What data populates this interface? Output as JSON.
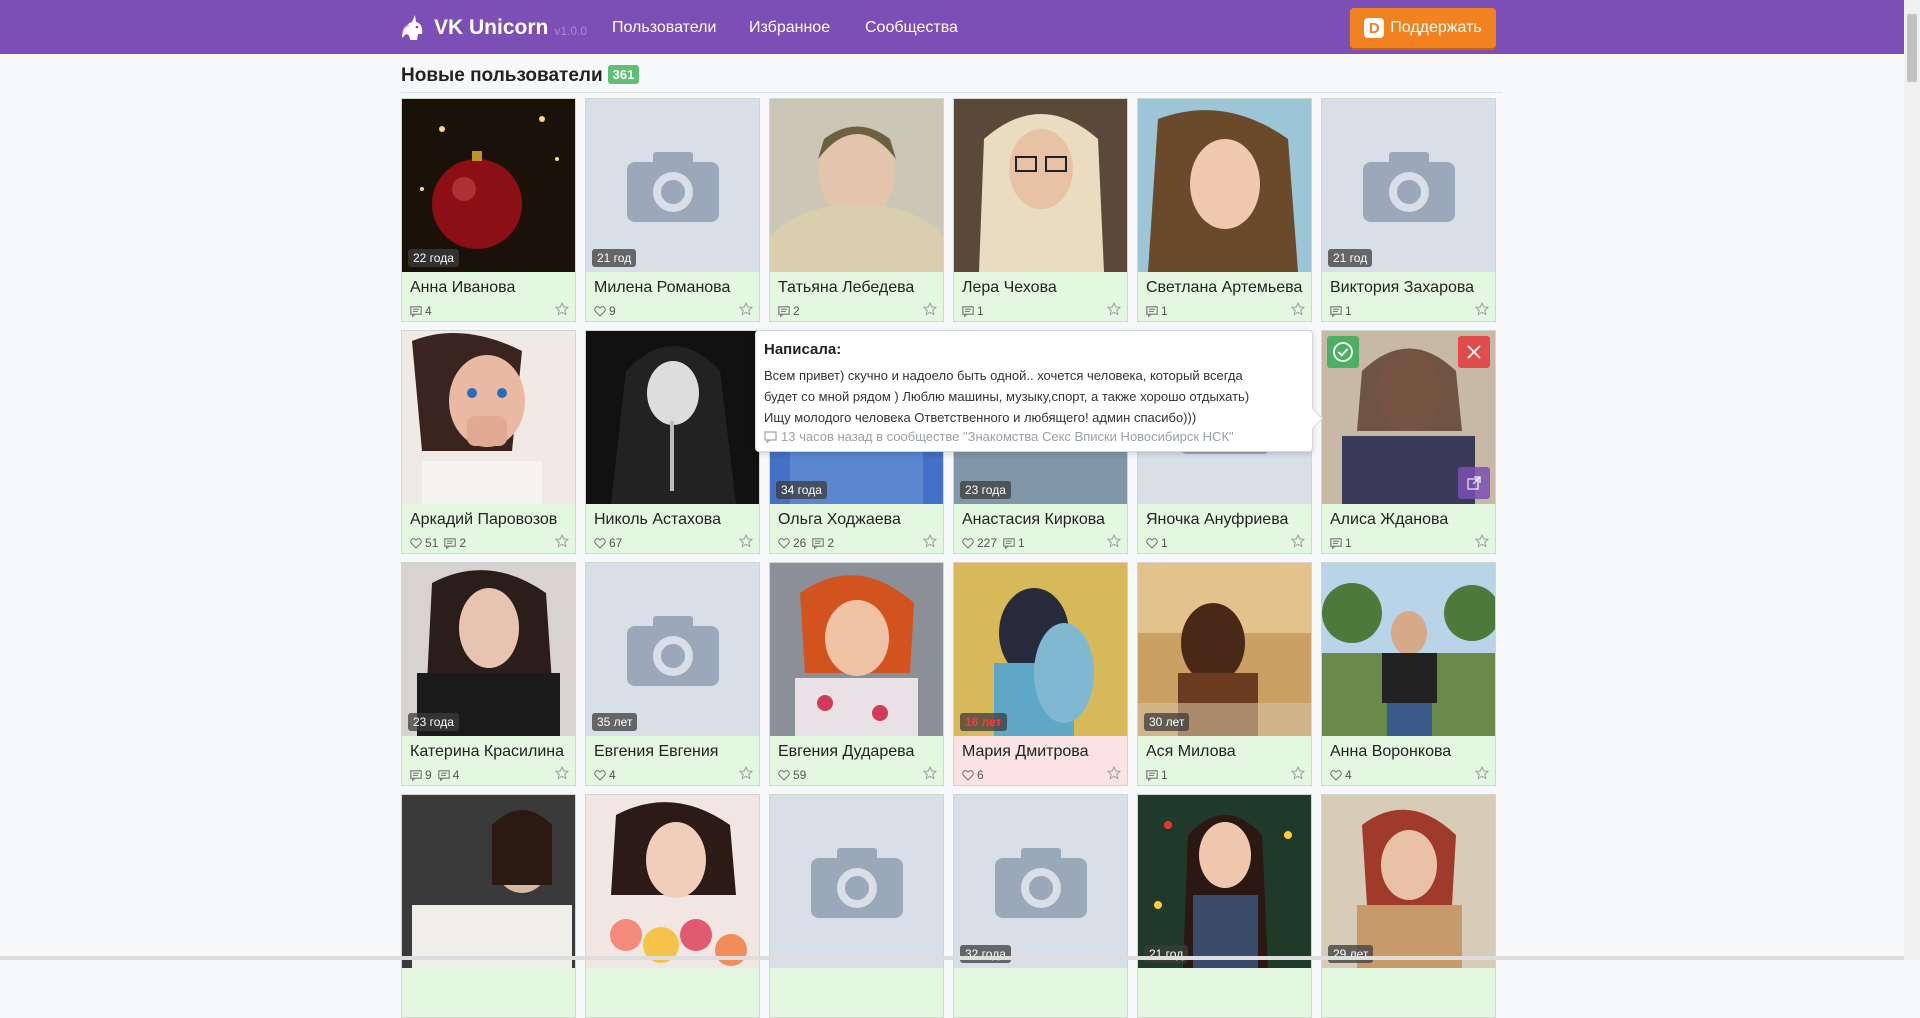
{
  "app": {
    "name": "VK Unicorn",
    "version": "v1.0.0",
    "nav": [
      "Пользователи",
      "Избранное",
      "Сообщества"
    ],
    "donate": "Поддержать",
    "donate_icon_letter": "D"
  },
  "section": {
    "title": "Новые пользователи",
    "count": "361"
  },
  "users": [
    {
      "name": "Анна Иванова",
      "age": "22 года",
      "likes": "",
      "comments": "4",
      "photo": "red-ornament",
      "highlight": false
    },
    {
      "name": "Милена Романова",
      "age": "21 год",
      "likes": "9",
      "comments": "",
      "photo": "placeholder",
      "highlight": false
    },
    {
      "name": "Татьяна Лебедева",
      "age": "",
      "likes": "",
      "comments": "2",
      "photo": "fur-coat",
      "highlight": false
    },
    {
      "name": "Лера Чехова",
      "age": "",
      "likes": "",
      "comments": "1",
      "photo": "glasses-blonde",
      "highlight": false
    },
    {
      "name": "Светлана Артемьева",
      "age": "",
      "likes": "",
      "comments": "1",
      "photo": "selfie",
      "highlight": false
    },
    {
      "name": "Виктория Захарова",
      "age": "21 год",
      "likes": "",
      "comments": "1",
      "photo": "placeholder",
      "highlight": false
    },
    {
      "name": "Аркадий Паровозов",
      "age": "",
      "likes": "51",
      "comments": "2",
      "photo": "blue-nails",
      "highlight": false
    },
    {
      "name": "Николь Астахова",
      "age": "",
      "likes": "67",
      "comments": "",
      "photo": "black-white",
      "highlight": false
    },
    {
      "name": "Ольга Ходжаева",
      "age": "34 года",
      "likes": "26",
      "comments": "2",
      "photo": "blue",
      "highlight": false
    },
    {
      "name": "Анастасия Киркова",
      "age": "23 года",
      "likes": "227",
      "comments": "1",
      "photo": "beach",
      "highlight": false
    },
    {
      "name": "Яночка Ануфриева",
      "age": "",
      "likes": "1",
      "comments": "",
      "photo": "placeholder",
      "highlight": false
    },
    {
      "name": "Алиса Жданова",
      "age": "",
      "likes": "",
      "comments": "1",
      "photo": "jacket",
      "highlight": false
    },
    {
      "name": "Катерина Красилина",
      "age": "23 года",
      "likes": "",
      "comments": "9",
      "extra": "4",
      "photo": "dark-jacket",
      "highlight": false
    },
    {
      "name": "Евгения Евгения",
      "age": "35 лет",
      "likes": "4",
      "comments": "",
      "photo": "placeholder",
      "highlight": false
    },
    {
      "name": "Евгения Дударева",
      "age": "",
      "likes": "59",
      "comments": "",
      "photo": "redhead",
      "highlight": false
    },
    {
      "name": "Мария Дмитрова",
      "age": "16 лет",
      "likes": "6",
      "comments": "",
      "photo": "couple",
      "highlight": true
    },
    {
      "name": "Ася Милова",
      "age": "30 лет",
      "likes": "",
      "comments": "1",
      "photo": "sepia",
      "highlight": false
    },
    {
      "name": "Анна Воронкова",
      "age": "",
      "likes": "4",
      "comments": "",
      "photo": "park",
      "highlight": false
    },
    {
      "name": "",
      "age": "",
      "likes": "",
      "comments": "",
      "photo": "car",
      "highlight": false
    },
    {
      "name": "",
      "age": "",
      "likes": "",
      "comments": "",
      "photo": "flowers",
      "highlight": false
    },
    {
      "name": "",
      "age": "",
      "likes": "",
      "comments": "",
      "photo": "placeholder",
      "highlight": false
    },
    {
      "name": "",
      "age": "32 года",
      "likes": "",
      "comments": "",
      "photo": "placeholder",
      "highlight": false
    },
    {
      "name": "",
      "age": "21 год",
      "likes": "",
      "comments": "",
      "photo": "xmas",
      "highlight": false
    },
    {
      "name": "",
      "age": "29 лет",
      "likes": "",
      "comments": "",
      "photo": "older",
      "highlight": false
    }
  ],
  "tooltip": {
    "title": "Написала:",
    "line1": "Всем привет) скучно и надоело быть одной.. хочется человека, который всегда",
    "line2": "будет со мной рядом ) Люблю машины, музыку,спорт, а также хорошо отдыхать)",
    "line3": "Ищу молодого человека Ответственного и любящего! админ спасибо)))",
    "meta": "13 часов назад в сообществе \"Знакомства Секс Вписки Новосибирск НСК\""
  },
  "colors": {
    "nav_bg": "#7b4fb5",
    "donate": "#f1821f",
    "badge": "#5fbf72",
    "card_bg": "#e4f7e0",
    "card_alert": "#fbe3e4"
  },
  "icons": [
    "unicorn-logo-icon",
    "donate-icon",
    "camera-icon",
    "heart-icon",
    "comment-icon",
    "star-icon",
    "check-icon",
    "close-icon",
    "external-link-icon"
  ]
}
